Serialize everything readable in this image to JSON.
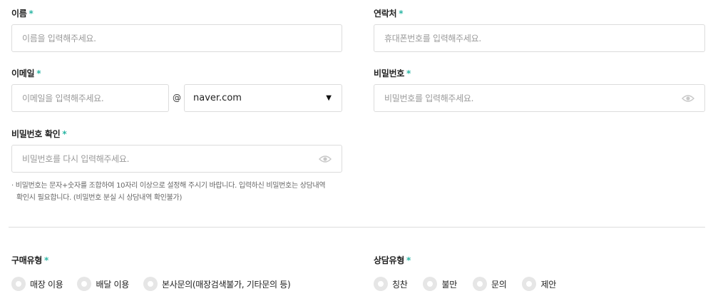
{
  "form": {
    "name": {
      "label": "이름",
      "required_mark": "*",
      "placeholder": "이름을 입력해주세요."
    },
    "contact": {
      "label": "연락처",
      "required_mark": "*",
      "placeholder": "휴대폰번호를 입력해주세요."
    },
    "email": {
      "label": "이메일",
      "required_mark": "*",
      "placeholder": "이메일을 입력해주세요.",
      "at_symbol": "@",
      "domain_selected": "naver.com"
    },
    "password": {
      "label": "비밀번호",
      "required_mark": "*",
      "placeholder": "비밀번호를 입력해주세요."
    },
    "password_confirm": {
      "label": "비밀번호 확인",
      "required_mark": "*",
      "placeholder": "비밀번호를 다시 입력해주세요."
    },
    "password_note": {
      "line1": "· 비밀번호는 문자+숫자를 조합하여 10자리 이상으로 설정해 주시기 바랍니다. 입력하신 비밀번호는 상담내역",
      "line2": "확인시 필요합니다. (비밀번호 분실 시 상담내역 확인불가)"
    },
    "purchase_type": {
      "label": "구매유형",
      "required_mark": "*",
      "options": [
        "매장 이용",
        "배달 이용",
        "본사문의(매장검색불가, 기타문의 등)"
      ]
    },
    "consult_type": {
      "label": "상담유형",
      "required_mark": "*",
      "options": [
        "칭찬",
        "불만",
        "문의",
        "제안"
      ]
    }
  },
  "icons": {
    "eye": "eye-icon",
    "dropdown": "triangle-down-icon"
  },
  "colors": {
    "accent": "#2bb5a4",
    "border": "#dcdcdc",
    "radio": "#e6e6e6"
  }
}
